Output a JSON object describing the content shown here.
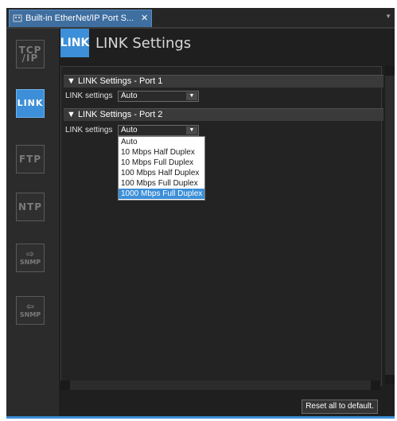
{
  "tab": {
    "title": "Built-in EtherNet/IP Port S...",
    "close": "✕"
  },
  "sidebar": {
    "items": [
      {
        "line1": "TCP",
        "line2": "/IP"
      },
      {
        "line1": "LINK"
      },
      {
        "line1": "FTP"
      },
      {
        "line1": "NTP"
      },
      {
        "arrow": "⇨",
        "line1": "SNMP"
      },
      {
        "arrow": "⇦",
        "line1": "SNMP"
      }
    ]
  },
  "header": {
    "icon_text": "LINK",
    "title": "LINK Settings"
  },
  "sections": [
    {
      "title": "▼ LINK Settings - Port 1",
      "label": "LINK settings",
      "value": "Auto"
    },
    {
      "title": "▼ LINK Settings - Port 2",
      "label": "LINK settings",
      "value": "Auto"
    }
  ],
  "dropdown": {
    "options": [
      "Auto",
      "10 Mbps Half Duplex",
      "10 Mbps Full Duplex",
      "100 Mbps Half Duplex",
      "100 Mbps Full Duplex",
      "1000 Mbps Full Duplex"
    ],
    "highlighted": "1000 Mbps Full Duplex"
  },
  "footer": {
    "reset_label": "Reset all to default."
  },
  "colors": {
    "accent": "#3c8fd8",
    "background": "#1f1f1f"
  }
}
